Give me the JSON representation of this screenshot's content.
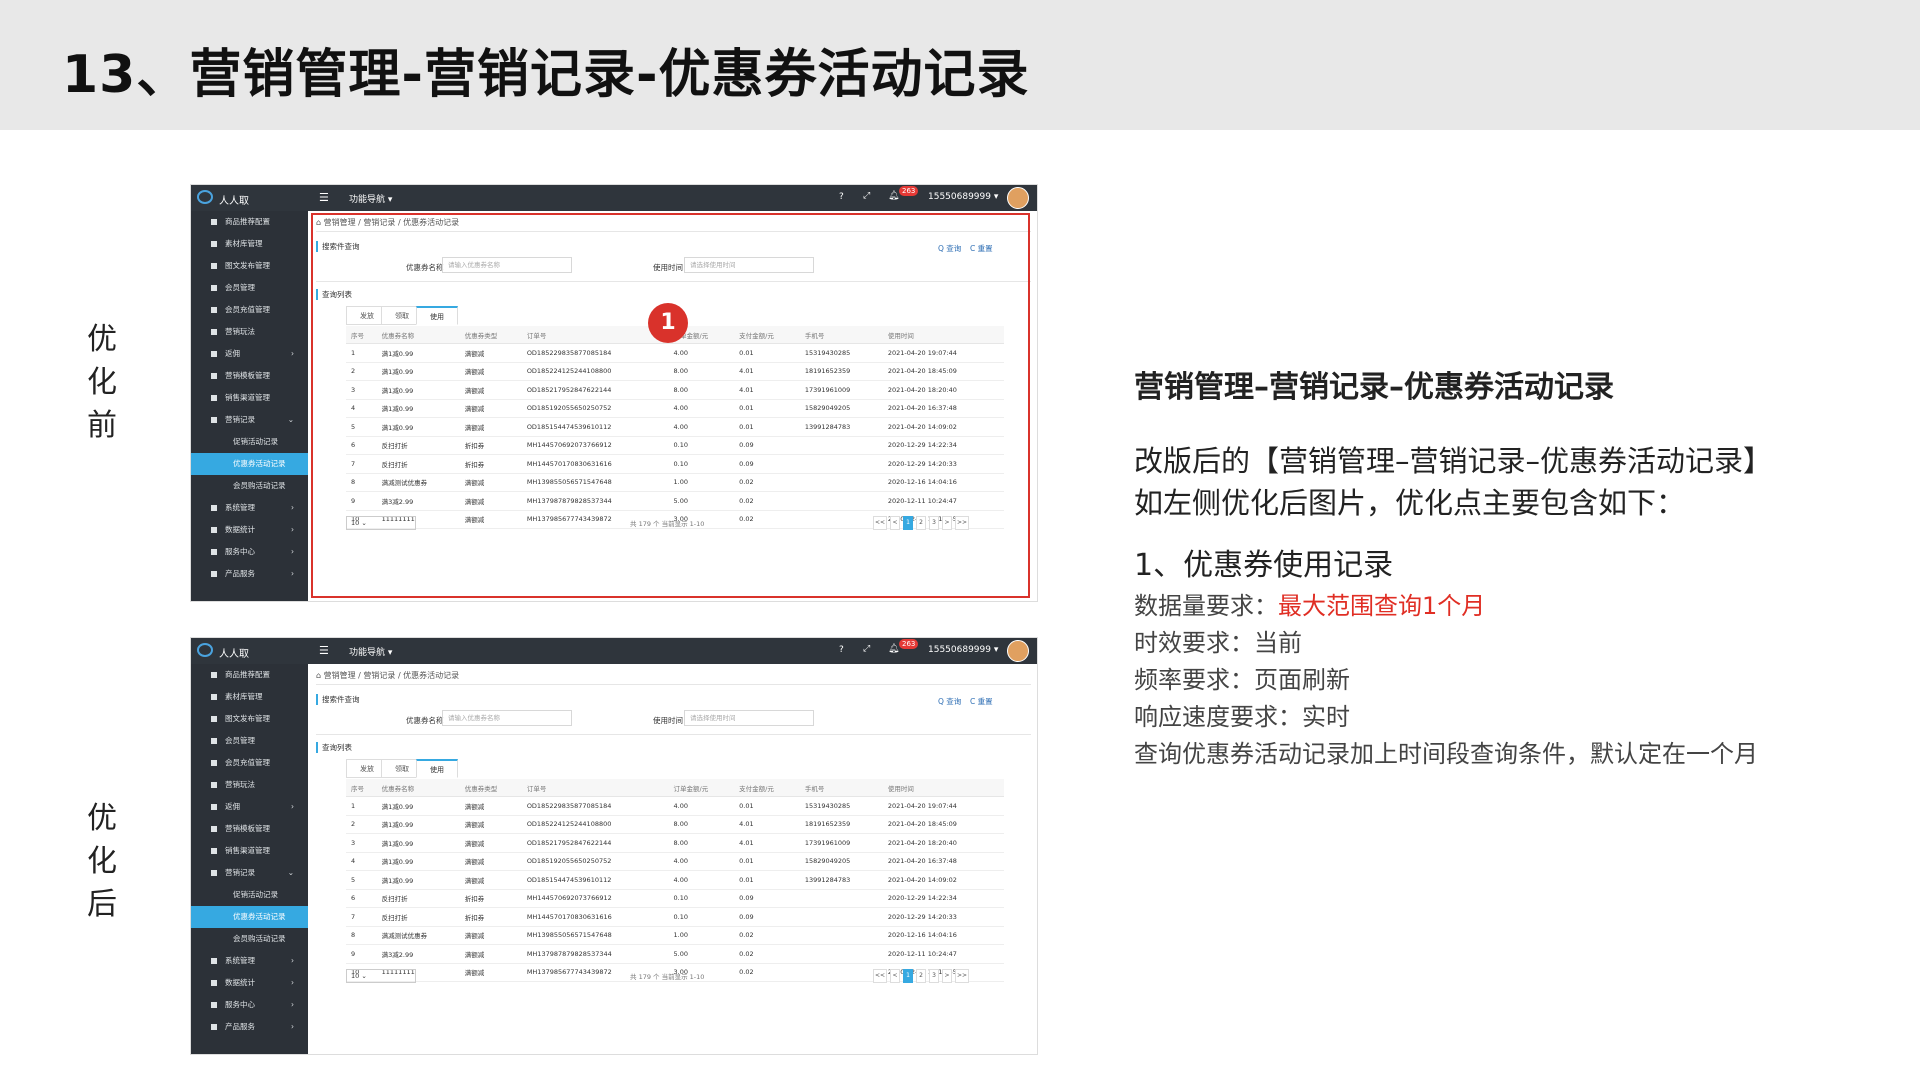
{
  "slide": {
    "title": "13、营销管理-营销记录-优惠券活动记录",
    "before_label": [
      "优",
      "化",
      "前"
    ],
    "after_label": [
      "优",
      "化",
      "后"
    ]
  },
  "app": {
    "brand": "人人取",
    "nav": "功能导航 ▾",
    "help": "?",
    "badge": "263",
    "user": "15550689999 ▾",
    "sidebar": [
      {
        "label": "商品推荐配置",
        "arrow": ""
      },
      {
        "label": "素材库管理",
        "arrow": ""
      },
      {
        "label": "图文发布管理",
        "arrow": ""
      },
      {
        "label": "会员管理",
        "arrow": ""
      },
      {
        "label": "会员充值管理",
        "arrow": ""
      },
      {
        "label": "营销玩法",
        "arrow": ""
      },
      {
        "label": "返佣",
        "arrow": "›"
      },
      {
        "label": "营销模板管理",
        "arrow": ""
      },
      {
        "label": "销售渠道管理",
        "arrow": ""
      },
      {
        "label": "营销记录",
        "arrow": "⌄"
      }
    ],
    "sidebar_sub": [
      "促销活动记录",
      "优惠券活动记录",
      "会员购活动记录"
    ],
    "sidebar_bottom": [
      {
        "label": "系统管理",
        "arrow": "›"
      },
      {
        "label": "数据统计",
        "arrow": "›"
      },
      {
        "label": "服务中心",
        "arrow": "›"
      },
      {
        "label": "产品服务",
        "arrow": "›"
      }
    ],
    "breadcrumb": "⌂  营销管理 / 营销记录 / 优惠券活动记录",
    "search_title": "搜索件查询",
    "coupon_name_label": "优惠券名称",
    "coupon_name_placeholder": "请输入优惠券名称",
    "use_time_label": "使用时间",
    "use_time_placeholder": "请选择使用时间",
    "query_btn": "Q 查询",
    "reset_btn": "C 重置",
    "list_title": "查询列表",
    "tabs": [
      "发放",
      "领取",
      "使用"
    ],
    "columns": [
      "序号",
      "优惠券名称",
      "优惠券类型",
      "订单号",
      "订单金额/元",
      "支付金额/元",
      "手机号",
      "使用时间"
    ],
    "rows": [
      [
        "1",
        "满1减0.99",
        "满额减",
        "OD185229835877085184",
        "4.00",
        "0.01",
        "15319430285",
        "2021-04-20 19:07:44"
      ],
      [
        "2",
        "满1减0.99",
        "满额减",
        "OD185224125244108800",
        "8.00",
        "4.01",
        "18191652359",
        "2021-04-20 18:45:09"
      ],
      [
        "3",
        "满1减0.99",
        "满额减",
        "OD185217952847622144",
        "8.00",
        "4.01",
        "17391961009",
        "2021-04-20 18:20:40"
      ],
      [
        "4",
        "满1减0.99",
        "满额减",
        "OD185192055650250752",
        "4.00",
        "0.01",
        "15829049205",
        "2021-04-20 16:37:48"
      ],
      [
        "5",
        "满1减0.99",
        "满额减",
        "OD185154474539610112",
        "4.00",
        "0.01",
        "13991284783",
        "2021-04-20 14:09:02"
      ],
      [
        "6",
        "反扫打折",
        "折扣券",
        "MH144570692073766912",
        "0.10",
        "0.09",
        "",
        "2020-12-29 14:22:34"
      ],
      [
        "7",
        "反扫打折",
        "折扣券",
        "MH144570170830631616",
        "0.10",
        "0.09",
        "",
        "2020-12-29 14:20:33"
      ],
      [
        "8",
        "满减测试优惠券",
        "满额减",
        "MH139855056571547648",
        "1.00",
        "0.02",
        "",
        "2020-12-16 14:04:16"
      ],
      [
        "9",
        "满3减2.99",
        "满额减",
        "MH137987879828537344",
        "5.00",
        "0.02",
        "",
        "2020-12-11 10:24:47"
      ],
      [
        "10",
        "11111111",
        "满额减",
        "MH137985677743439872",
        "3.00",
        "0.02",
        "",
        "2020-12-11 10:15:55"
      ]
    ],
    "page_size": "10",
    "pager_info": "共 179 个  当前显示 1-10",
    "pager": [
      "<<",
      "<",
      "1",
      "2",
      "3",
      ">",
      ">>"
    ]
  },
  "marker": "1",
  "right": {
    "title": "营销管理–营销记录–优惠券活动记录",
    "para": "改版后的【营销管理–营销记录–优惠券活动记录】如左侧优化后图片，优化点主要包含如下：",
    "sub": "1、优惠券使用记录",
    "req1_label": "数据量要求：",
    "req1_value": "最大范围查询1个月",
    "req2": "时效要求：当前",
    "req3": "频率要求：页面刷新",
    "req4": "响应速度要求：实时",
    "req5": "查询优惠券活动记录加上时间段查询条件，默认定在一个月"
  },
  "colors": {
    "accent": "#36a9e1",
    "highlight": "#e02e24",
    "marker": "#d9322b"
  }
}
